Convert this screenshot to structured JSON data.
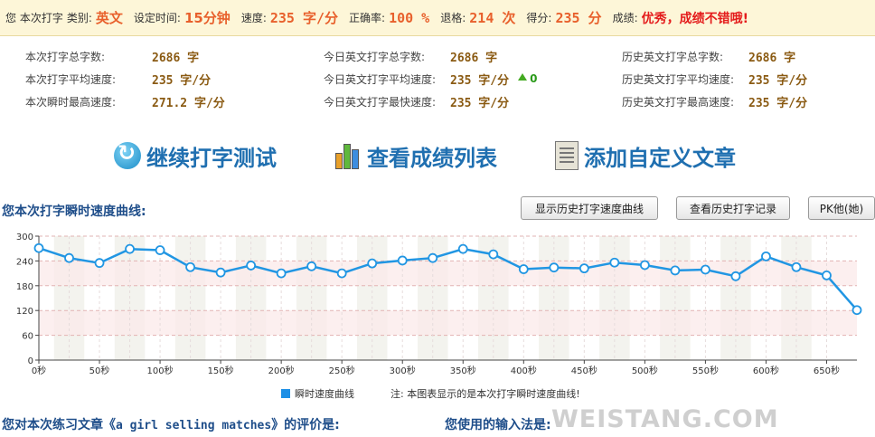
{
  "topbar": {
    "user_label": "您 本次打字",
    "category_label": "类别:",
    "category_value": "英文",
    "time_label": "设定时间:",
    "time_value": "15分钟",
    "speed_label": "速度:",
    "speed_value": "235 字/分",
    "accuracy_label": "正确率:",
    "accuracy_value": "100 %",
    "backspace_label": "退格:",
    "backspace_value": "214 次",
    "score_label": "得分:",
    "score_value": "235 分",
    "grade_label": "成绩:",
    "grade_value": "优秀，成绩不错哦!"
  },
  "stats": {
    "col1": [
      {
        "label": "本次打字总字数:",
        "value": "2686 字"
      },
      {
        "label": "本次打字平均速度:",
        "value": "235 字/分"
      },
      {
        "label": "本次瞬时最高速度:",
        "value": "271.2 字/分"
      }
    ],
    "col2": [
      {
        "label": "今日英文打字总字数:",
        "value": "2686 字"
      },
      {
        "label": "今日英文打字平均速度:",
        "value": "235 字/分"
      },
      {
        "label": "今日英文打字最快速度:",
        "value": "235 字/分"
      }
    ],
    "col2_change": "0",
    "col3": [
      {
        "label": "历史英文打字总字数:",
        "value": "2686 字"
      },
      {
        "label": "历史英文打字平均速度:",
        "value": "235 字/分"
      },
      {
        "label": "历史英文打字最高速度:",
        "value": "235 字/分"
      }
    ]
  },
  "actions": {
    "continue": "继续打字测试",
    "scores": "查看成绩列表",
    "custom": "添加自定义文章",
    "icons": [
      "refresh-icon",
      "bar-chart-icon",
      "document-icon"
    ]
  },
  "chart_header": {
    "title": "您本次打字瞬时速度曲线:",
    "btn_history_curve": "显示历史打字速度曲线",
    "btn_history_record": "查看历史打字记录",
    "btn_pk": "PK他(她)"
  },
  "chart_data": {
    "type": "line",
    "x": [
      0,
      25,
      50,
      75,
      100,
      125,
      150,
      175,
      200,
      225,
      250,
      275,
      300,
      325,
      350,
      375,
      400,
      425,
      450,
      475,
      500,
      525,
      550,
      575,
      600,
      625,
      650,
      675
    ],
    "series": [
      {
        "name": "瞬时速度曲线",
        "values": [
          271,
          247,
          235,
          269,
          266,
          225,
          212,
          229,
          210,
          227,
          210,
          234,
          241,
          247,
          269,
          256,
          220,
          224,
          222,
          236,
          230,
          217,
          219,
          203,
          251,
          225,
          205,
          121
        ],
        "color": "#2196e3"
      }
    ],
    "x_ticks": [
      "0秒",
      "50秒",
      "100秒",
      "150秒",
      "200秒",
      "250秒",
      "300秒",
      "350秒",
      "400秒",
      "450秒",
      "500秒",
      "550秒",
      "600秒",
      "650秒"
    ],
    "x_tick_values": [
      0,
      50,
      100,
      150,
      200,
      250,
      300,
      350,
      400,
      450,
      500,
      550,
      600,
      650
    ],
    "y_ticks": [
      0,
      60,
      120,
      180,
      240,
      300
    ],
    "xlim": [
      0,
      675
    ],
    "ylim": [
      0,
      300
    ],
    "grid": true,
    "legend": "bottom-center"
  },
  "legend_note": "注: 本图表显示的是本次打字瞬时速度曲线!",
  "footer": {
    "review_prefix": "您对本次练习文章《",
    "article_name": "a girl selling matches",
    "review_suffix": "》的评价是:",
    "input_method": "您使用的输入法是:"
  },
  "watermark": "WEISTANG.COM"
}
